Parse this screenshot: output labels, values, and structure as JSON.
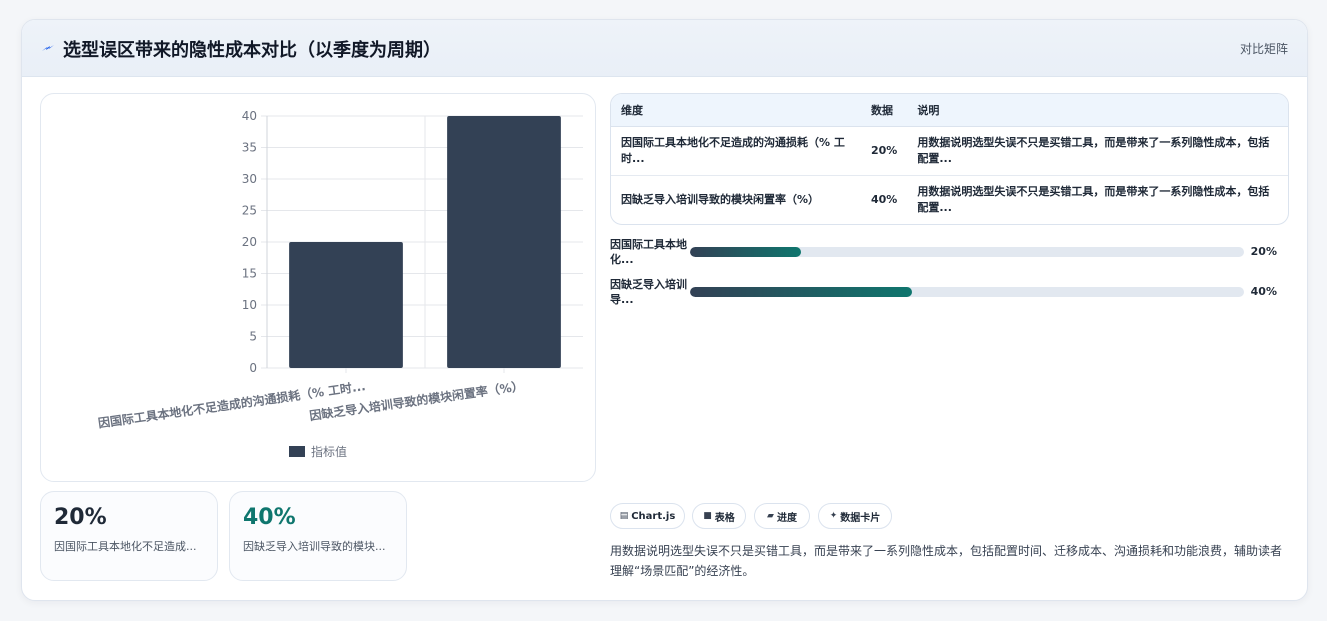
{
  "header": {
    "icon": "sparkle-icon",
    "title": "选型误区带来的隐性成本对比（以季度为周期）",
    "right_label": "对比矩阵",
    "accent": "#2563eb"
  },
  "chart_data": {
    "type": "bar",
    "categories": [
      "因国际工具本地化不足造成的沟通损耗（% 工时...",
      "因缺乏导入培训导致的模块闲置率（%）"
    ],
    "series": [
      {
        "name": "指标值",
        "values": [
          20,
          40
        ],
        "color": "#334155"
      }
    ],
    "ylim": [
      0,
      40
    ],
    "yticks": [
      0,
      5,
      10,
      15,
      20,
      25,
      30,
      35,
      40
    ],
    "grid": true,
    "legend": "bottom-center"
  },
  "stats": [
    {
      "value": "20%",
      "label": "因国际工具本地化不足造成...",
      "color": "#1f2937"
    },
    {
      "value": "40%",
      "label": "因缺乏导入培训导致的模块...",
      "color": "#0f766e"
    }
  ],
  "table": {
    "headers": [
      "维度",
      "数据",
      "说明"
    ],
    "rows": [
      {
        "dim": "因国际工具本地化不足造成的沟通损耗（% 工时...",
        "data": "20%",
        "note": "用数据说明选型失误不只是买错工具，而是带来了一系列隐性成本，包括配置..."
      },
      {
        "dim": "因缺乏导入培训导致的模块闲置率（%）",
        "data": "40%",
        "note": "用数据说明选型失误不只是买错工具，而是带来了一系列隐性成本，包括配置..."
      }
    ]
  },
  "progress": [
    {
      "label": "因国际工具本地化...",
      "value": 0.2,
      "pct": "20%"
    },
    {
      "label": "因缺乏导入培训导...",
      "value": 0.4,
      "pct": "40%"
    }
  ],
  "chips": [
    {
      "icon": "chart-icon",
      "glyph": "▤",
      "label": "Chart.js"
    },
    {
      "icon": "table-icon",
      "glyph": "■",
      "label": "表格"
    },
    {
      "icon": "folder-icon",
      "glyph": "▰",
      "label": "进度"
    },
    {
      "icon": "sparkle-icon",
      "glyph": "✦",
      "label": "数据卡片"
    }
  ],
  "description": "用数据说明选型失误不只是买错工具，而是带来了一系列隐性成本，包括配置时间、迁移成本、沟通损耗和功能浪费，辅助读者理解“场景匹配”的经济性。"
}
